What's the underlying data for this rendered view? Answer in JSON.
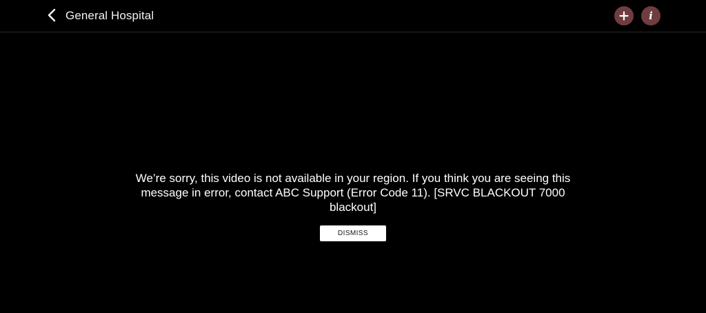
{
  "header": {
    "back_icon": "chevron-left-icon",
    "title": "General Hospital",
    "add_icon": "plus-icon",
    "info_icon": "info-icon",
    "info_glyph": "i",
    "accent_color": "#6f3d3f"
  },
  "error": {
    "message": "We’re sorry, this video is not available in your region. If you think you are seeing this message in error, contact ABC Support (Error Code 11). [SRVC BLACKOUT 7000 blackout]",
    "dismiss_label": "DISMISS"
  }
}
